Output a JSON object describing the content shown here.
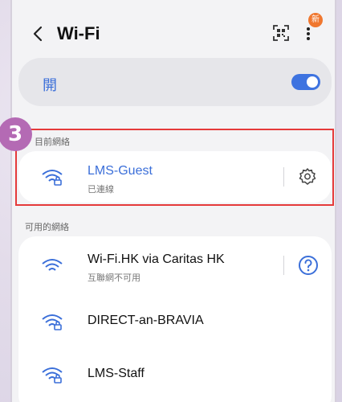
{
  "header": {
    "title": "Wi-Fi",
    "badge": "新"
  },
  "toggle": {
    "label": "開",
    "state": "on"
  },
  "step": {
    "number": "3"
  },
  "current": {
    "section_label": "目前網絡",
    "network": {
      "name": "LMS-Guest",
      "status": "已連線"
    }
  },
  "available": {
    "section_label": "可用的網絡",
    "networks": [
      {
        "name": "Wi-Fi.HK via Caritas HK",
        "status": "互聯網不可用"
      },
      {
        "name": "DIRECT-an-BRAVIA",
        "status": ""
      },
      {
        "name": "LMS-Staff",
        "status": ""
      }
    ]
  },
  "colors": {
    "accent": "#3b6fd9",
    "highlight_border": "#e53a3a",
    "step_badge": "#b46ab4",
    "notification_badge": "#f0772f"
  }
}
